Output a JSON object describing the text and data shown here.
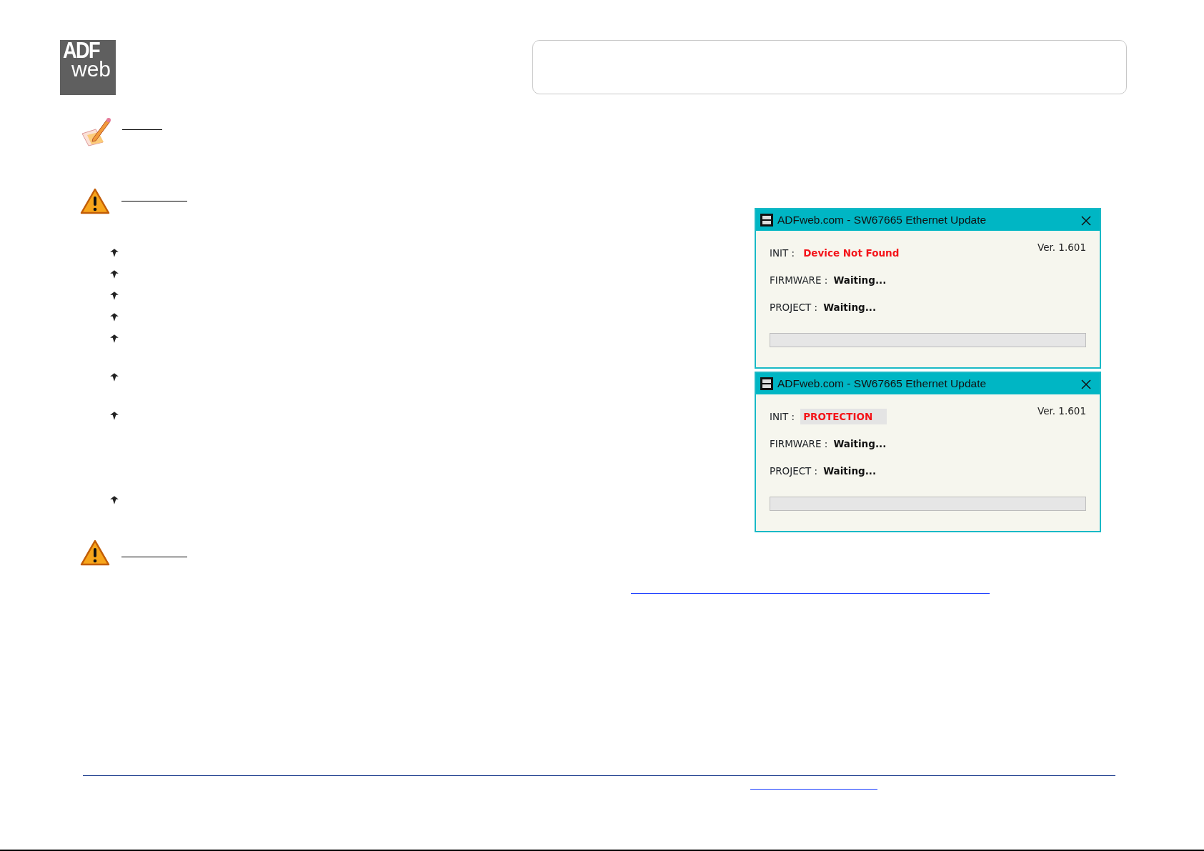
{
  "logo": {
    "line_1": "ADF",
    "line_2": "web"
  },
  "dialogs": [
    {
      "title": "ADFweb.com - SW67665 Ethernet Update",
      "version": "Ver. 1.601",
      "init_label": "INIT :",
      "init_value": "Device Not Found",
      "init_highlighted": false,
      "firmware_label": "FIRMWARE :",
      "firmware_value": "Waiting...",
      "project_label": "PROJECT :",
      "project_value": "Waiting...",
      "level": 0
    },
    {
      "title": "ADFweb.com - SW67665 Ethernet Update",
      "version": "Ver. 1.601",
      "init_label": "INIT :",
      "init_value": "PROTECTION",
      "init_highlighted": true,
      "firmware_label": "FIRMWARE :",
      "firmware_value": "Waiting...",
      "project_label": "PROJECT :",
      "project_value": "Waiting...",
      "level": 0
    }
  ]
}
